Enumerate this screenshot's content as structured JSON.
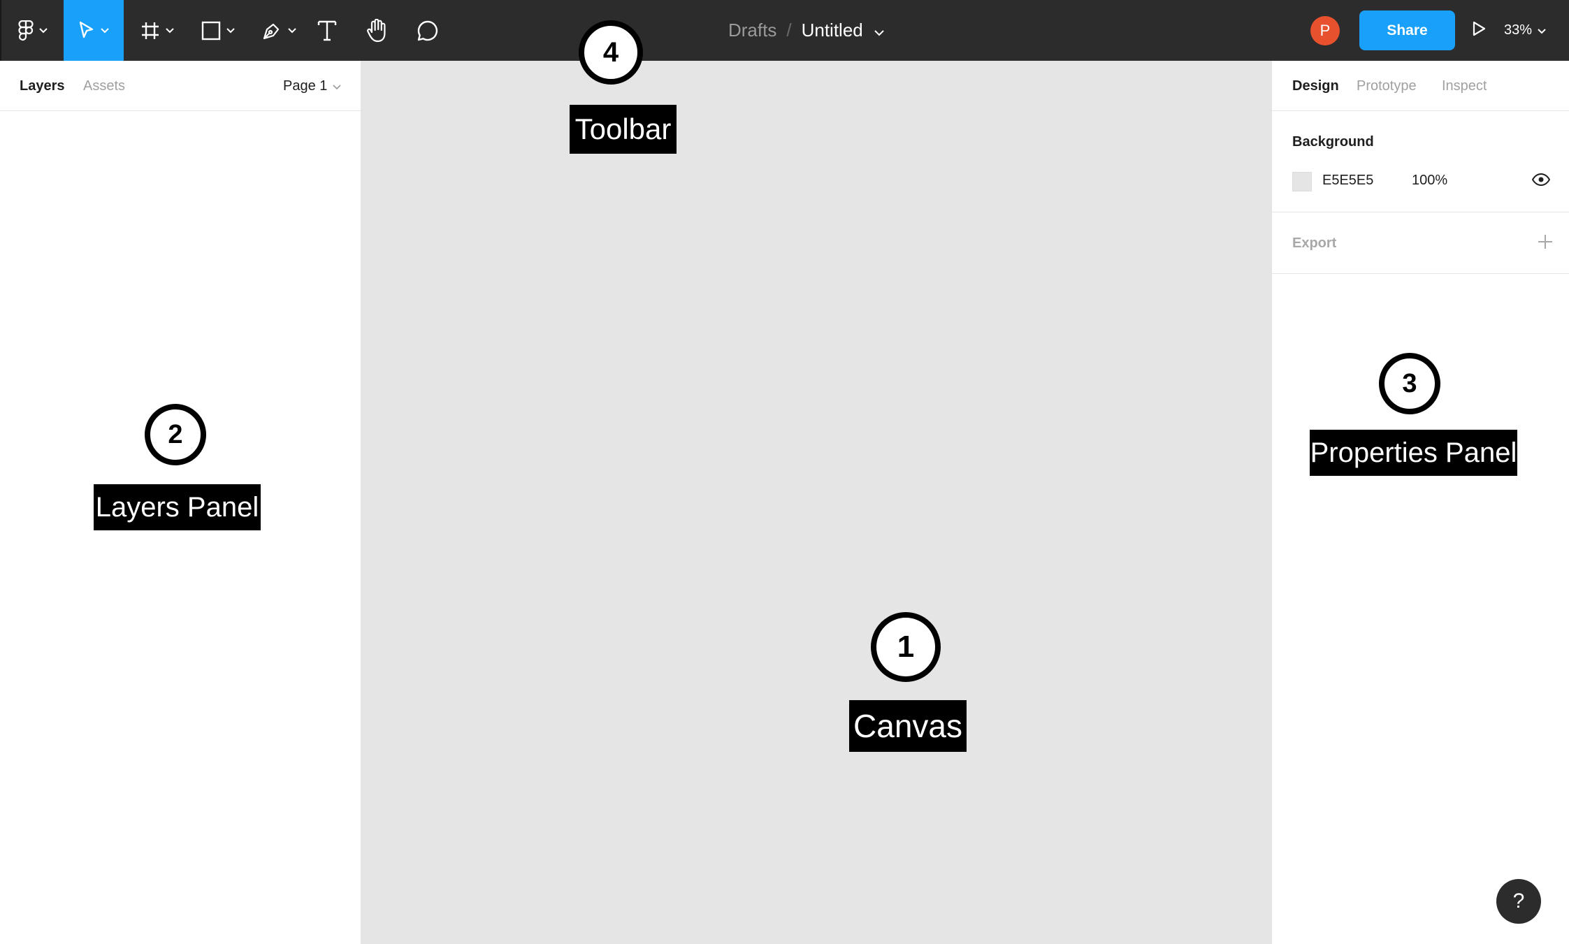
{
  "toolbar": {
    "tools": [
      {
        "name": "main-menu"
      },
      {
        "name": "move-tool"
      },
      {
        "name": "frame-tool"
      },
      {
        "name": "shape-tool"
      },
      {
        "name": "pen-tool"
      },
      {
        "name": "text-tool"
      },
      {
        "name": "hand-tool"
      },
      {
        "name": "comment-tool"
      }
    ],
    "breadcrumb": {
      "parent": "Drafts",
      "separator": "/",
      "title": "Untitled"
    },
    "avatar_initial": "P",
    "share_label": "Share",
    "zoom": "33%",
    "accent_color": "#18a0fb",
    "avatar_color": "#e7512d"
  },
  "left_panel": {
    "tabs": [
      "Layers",
      "Assets"
    ],
    "active_tab": "Layers",
    "page_selector": "Page 1"
  },
  "right_panel": {
    "tabs": [
      "Design",
      "Prototype",
      "Inspect"
    ],
    "active_tab": "Design",
    "background": {
      "title": "Background",
      "hex": "E5E5E5",
      "opacity": "100%"
    },
    "export": {
      "title": "Export"
    }
  },
  "help_label": "?",
  "annotations": [
    {
      "number": "1",
      "label": "Canvas"
    },
    {
      "number": "2",
      "label": "Layers Panel"
    },
    {
      "number": "3",
      "label": "Properties Panel"
    },
    {
      "number": "4",
      "label": "Toolbar"
    }
  ],
  "colors": {
    "canvas": "#e5e5e5",
    "toolbar": "#2c2c2c"
  }
}
